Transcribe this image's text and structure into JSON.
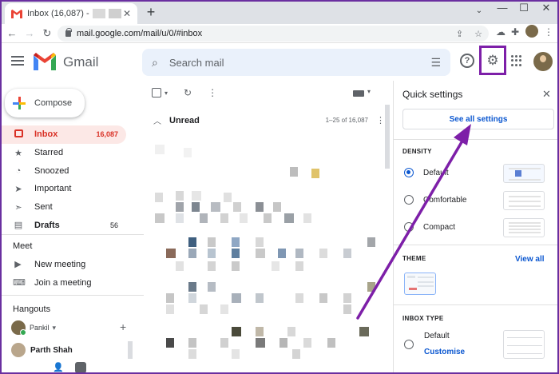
{
  "browser": {
    "tab_title": "Inbox (16,087) -",
    "new_tab": "+",
    "url": "mail.google.com/mail/u/0/#inbox",
    "window_controls": {
      "minimize": "—",
      "maximize": "☐",
      "close": "✕"
    }
  },
  "gmail": {
    "brand": "Gmail",
    "search": {
      "placeholder": "Search mail"
    },
    "compose_label": "Compose",
    "nav": [
      {
        "label": "Inbox",
        "count": "16,087",
        "icon": "inbox-icon"
      },
      {
        "label": "Starred",
        "count": "",
        "icon": "star-icon"
      },
      {
        "label": "Snoozed",
        "count": "",
        "icon": "clock-icon"
      },
      {
        "label": "Important",
        "count": "",
        "icon": "label-important-icon"
      },
      {
        "label": "Sent",
        "count": "",
        "icon": "send-icon"
      },
      {
        "label": "Drafts",
        "count": "56",
        "icon": "draft-icon"
      }
    ],
    "meet": {
      "title": "Meet",
      "new_meeting": "New meeting",
      "join_meeting": "Join a meeting"
    },
    "hangouts": {
      "title": "Hangouts",
      "user": "Pankil",
      "contact": "Parth Shah"
    },
    "list": {
      "section": "Unread",
      "range": "1–25 of 16,087"
    }
  },
  "quick_settings": {
    "title": "Quick settings",
    "see_all": "See all settings",
    "density": {
      "title": "DENSITY",
      "options": [
        "Default",
        "Comfortable",
        "Compact"
      ],
      "selected": "Default"
    },
    "theme": {
      "title": "THEME",
      "view_all": "View all"
    },
    "inbox_type": {
      "title": "INBOX TYPE",
      "option": "Default",
      "customise": "Customise"
    }
  },
  "colors": {
    "highlight_box": "#7d1fa8",
    "arrow": "#7d1fa8",
    "inbox_active_bg": "#fce8e6",
    "link_blue": "#0b57d0"
  }
}
